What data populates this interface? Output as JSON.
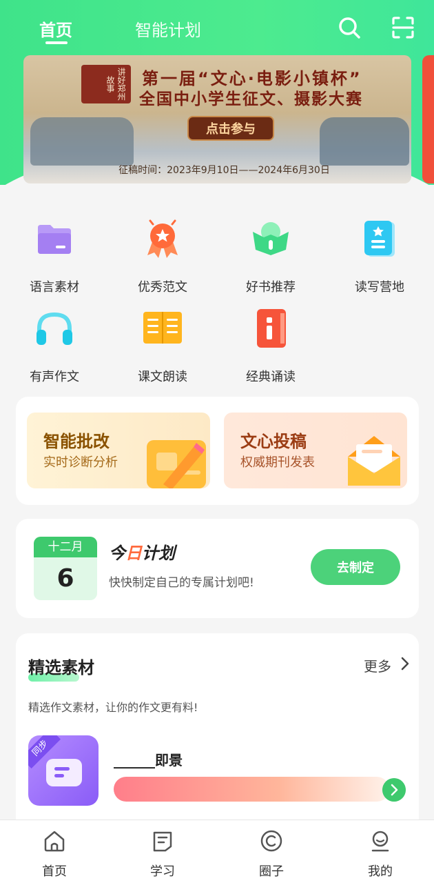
{
  "header": {
    "tabs": [
      {
        "label": "首页",
        "active": true
      },
      {
        "label": "智能计划",
        "active": false
      }
    ],
    "icons": [
      "search-icon",
      "scan-icon"
    ]
  },
  "banner": {
    "seal_text": "讲好郑州故事",
    "title_line1": "第一届“文心·电影小镇杯”",
    "title_line2": "全国中小学生征文、摄影大赛",
    "cta": "点击参与",
    "date": "征稿时间：2023年9月10日——2024年6月30日"
  },
  "grid": [
    {
      "label": "语言素材",
      "icon": "folder-icon",
      "color": "#a98bf5"
    },
    {
      "label": "优秀范文",
      "icon": "award-icon",
      "color": "#ff7a4a"
    },
    {
      "label": "好书推荐",
      "icon": "book-mascot-icon",
      "color": "#45d98a"
    },
    {
      "label": "读写营地",
      "icon": "star-card-icon",
      "color": "#2cc6f0"
    },
    {
      "label": "有声作文",
      "icon": "headphones-icon",
      "color": "#28cfe8"
    },
    {
      "label": "课文朗读",
      "icon": "open-book-icon",
      "color": "#ffb320"
    },
    {
      "label": "经典诵读",
      "icon": "notebook-icon",
      "color": "#f2553d"
    }
  ],
  "features": [
    {
      "title": "智能批改",
      "subtitle": "实时诊断分析",
      "icon": "pencil-paper-icon"
    },
    {
      "title": "文心投稿",
      "subtitle": "权威期刊发表",
      "icon": "envelope-icon"
    }
  ],
  "plan": {
    "month": "十二月",
    "day": "6",
    "title_prefix": "今",
    "title_highlight": "日",
    "title_suffix": "计划",
    "subtitle": "快快制定自己的专属计划吧!",
    "button": "去制定"
  },
  "materials": {
    "title": "精选素材",
    "more": "更多",
    "description": "精选作文素材，让你的作文更有料!",
    "item": {
      "tag": "同步",
      "title": "______即景"
    }
  },
  "bottom_nav": [
    {
      "label": "首页",
      "icon": "home-icon"
    },
    {
      "label": "学习",
      "icon": "study-icon"
    },
    {
      "label": "圈子",
      "icon": "circle-icon"
    },
    {
      "label": "我的",
      "icon": "profile-icon"
    }
  ]
}
